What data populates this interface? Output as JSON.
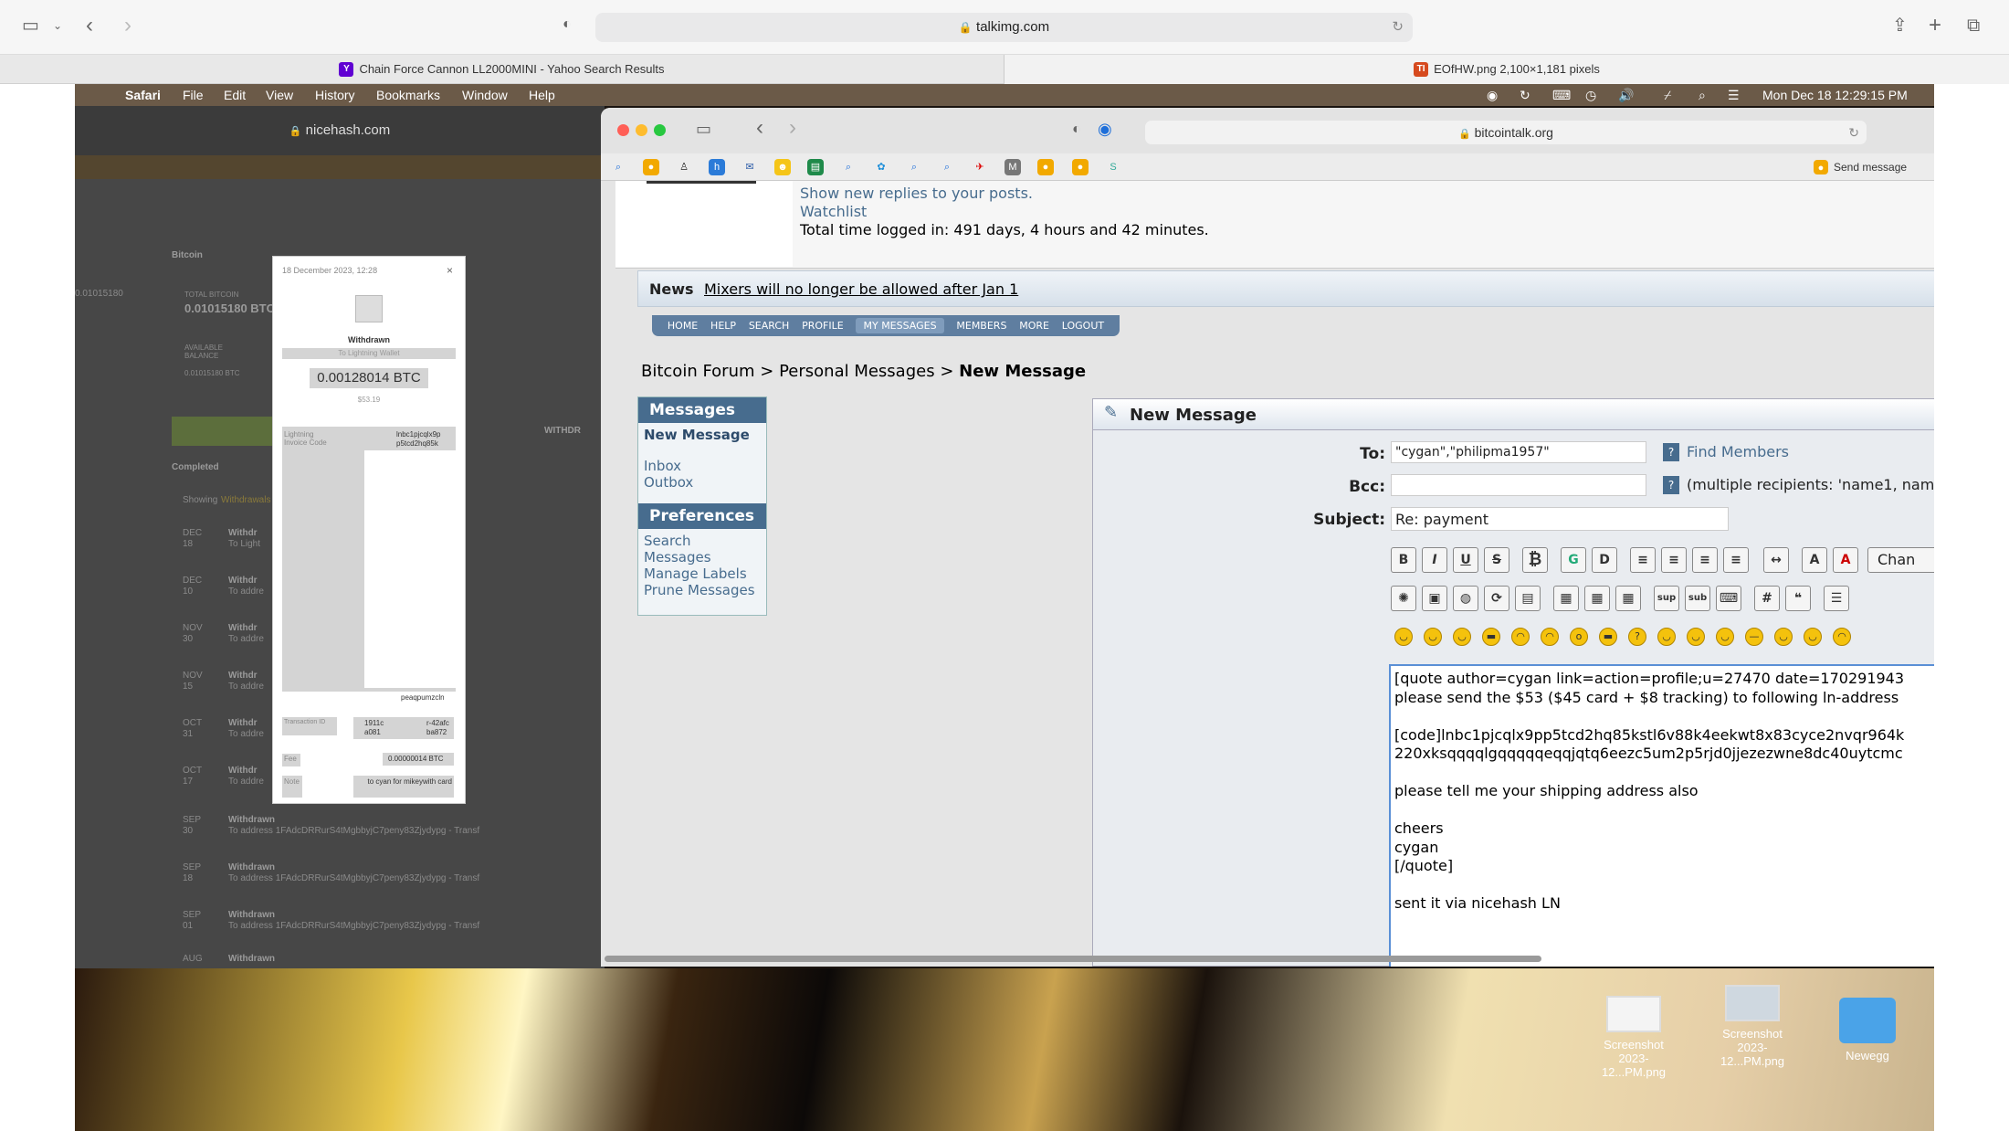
{
  "outer": {
    "url": "talkimg.com",
    "tabs": [
      {
        "label": "Chain Force Cannon LL2000MINI - Yahoo Search Results"
      },
      {
        "label": "EOfHW.png 2,100×1,181 pixels"
      }
    ]
  },
  "menubar": {
    "app": "Safari",
    "items": [
      "File",
      "Edit",
      "View",
      "History",
      "Bookmarks",
      "Window",
      "Help"
    ],
    "datetime": "Mon Dec 18  12:29:15 PM"
  },
  "nicehash": {
    "url": "nicehash.com",
    "bitcoin_label": "Bitcoin",
    "total_label": "TOTAL BITCOIN",
    "total_value": "0.01015180 BTC",
    "side_value": "0.01015180",
    "available_label": "AVAILABLE BALANCE",
    "available_value": "0.01015180 BTC",
    "withdraw_label": "WITHDR",
    "completed_label": "Completed",
    "showing_label": "Showing",
    "showing_value": "Withdrawals",
    "rows": [
      {
        "month": "DEC",
        "day": "18",
        "title": "Withdr",
        "sub": "To Light"
      },
      {
        "month": "DEC",
        "day": "10",
        "title": "Withdr",
        "sub": "To addre"
      },
      {
        "month": "NOV",
        "day": "30",
        "title": "Withdr",
        "sub": "To addre"
      },
      {
        "month": "NOV",
        "day": "15",
        "title": "Withdr",
        "sub": "To addre"
      },
      {
        "month": "OCT",
        "day": "31",
        "title": "Withdr",
        "sub": "To addre"
      },
      {
        "month": "OCT",
        "day": "17",
        "title": "Withdr",
        "sub": "To addre"
      },
      {
        "month": "SEP",
        "day": "30",
        "title": "Withdrawn",
        "sub": "To address 1FAdcDRRurS4tMgbbyjC7peny83Zjydypg - Transf"
      },
      {
        "month": "SEP",
        "day": "18",
        "title": "Withdrawn",
        "sub": "To address 1FAdcDRRurS4tMgbbyjC7peny83Zjydypg - Transf"
      },
      {
        "month": "SEP",
        "day": "01",
        "title": "Withdrawn",
        "sub": "To address 1FAdcDRRurS4tMgbbyjC7peny83Zjydypg - Transf"
      },
      {
        "month": "AUG",
        "day": "",
        "title": "Withdrawn",
        "sub": ""
      }
    ]
  },
  "modal": {
    "date": "18 December 2023, 12:28",
    "title": "Withdrawn",
    "subtitle": "To Lightning Wallet",
    "amount": "0.00128014 BTC",
    "usd": "$53.19",
    "invoice_label": "Lightning Invoice Code",
    "invoice_value_1": "lnbc1pjcqlx9p",
    "invoice_value_2": "p5tcd2hq85k",
    "invoice_tail": "peaqpumzcln",
    "txid_label": "Transaction ID",
    "txid_1": "1911c",
    "txid_2": "a081",
    "txid_3": "r-42afc",
    "txid_4": "ba872",
    "fee_label": "Fee",
    "fee_value": "0.00000014 BTC",
    "note_label": "Note",
    "note_value": "to cyan for mikeywith card"
  },
  "bitcointalk": {
    "url": "bitcointalk.org",
    "send_message": "Send message",
    "header_links": {
      "replies": "Show new replies to your posts.",
      "watchlist": "Watchlist",
      "logged": "Total time logged in: 491 days, 4 hours and 42 minutes."
    },
    "news_label": "News",
    "news_text": "Mixers will no longer be allowed after Jan 1",
    "nav": [
      "HOME",
      "HELP",
      "SEARCH",
      "PROFILE",
      "MY MESSAGES",
      "MEMBERS",
      "MORE",
      "LOGOUT"
    ],
    "breadcrumb": {
      "a": "Bitcoin Forum",
      "b": "Personal Messages",
      "c": "New Message",
      "sep": ">"
    },
    "sidebar": {
      "messages_header": "Messages",
      "new_message": "New Message",
      "inbox": "Inbox",
      "outbox": "Outbox",
      "preferences_header": "Preferences",
      "search": "Search Messages",
      "labels": "Manage Labels",
      "prune": "Prune Messages"
    },
    "form": {
      "header": "New Message",
      "to_label": "To:",
      "to_value": "\"cygan\",\"philipma1957\"",
      "find_members": "Find Members",
      "bcc_label": "Bcc:",
      "bcc_value": "",
      "bcc_hint": "(multiple recipients: 'name1, name2",
      "subject_label": "Subject:",
      "subject_value": "Re: payment",
      "change_btn": "Chan",
      "body_lines": [
        "[quote author=cygan link=action=profile;u=27470 date=170291943",
        "please send the $53 ($45 card + $8 tracking) to following ln-address",
        "",
        "[code]lnbc1pjcqlx9pp5tcd2hq85kstl6v88k4eekwt8x83cyce2nvqr964k",
        "220xksqqqqlgqqqqqeqqjqtq6eezc5um2p5rjd0jjezezwne8dc40uytcmc",
        "",
        "please tell me your shipping address also",
        "",
        "cheers",
        "cygan",
        "[/quote]",
        "",
        "sent it via nicehash LN"
      ]
    }
  },
  "desktop": {
    "icons": [
      {
        "label": "Screenshot 2023-12...PM.png"
      },
      {
        "label": "Screenshot 2023-12...PM.png"
      },
      {
        "label": "Newegg"
      }
    ]
  }
}
